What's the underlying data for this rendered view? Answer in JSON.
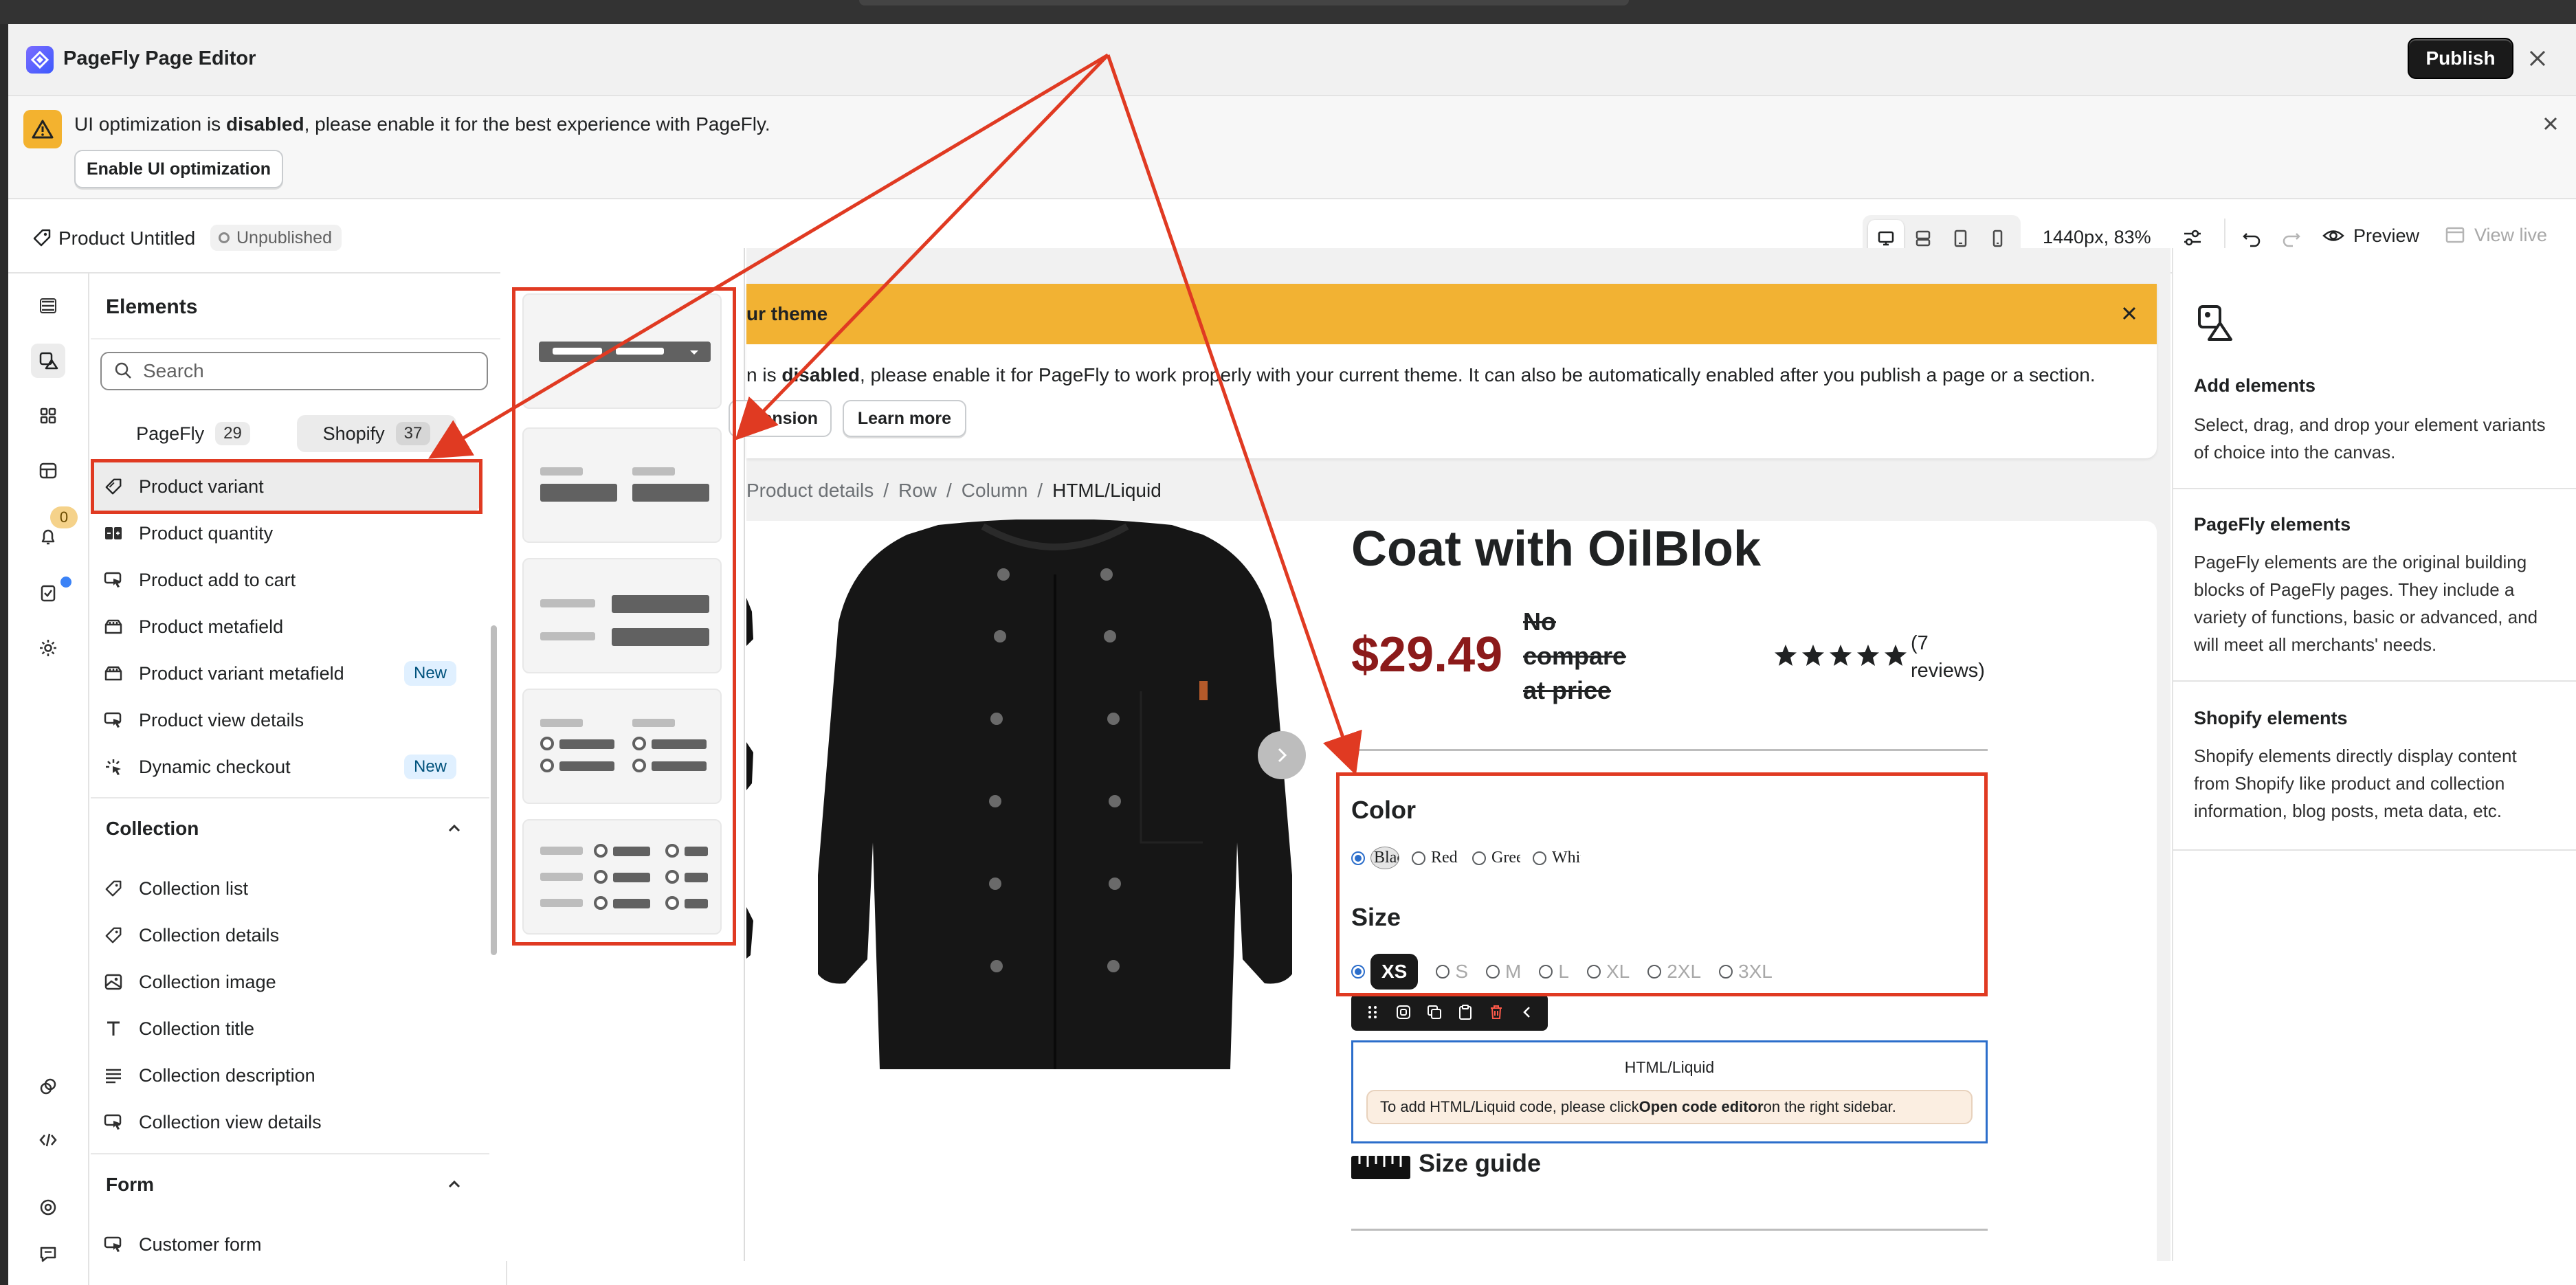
{
  "app": {
    "title": "PageFly Page Editor",
    "publish_label": "Publish"
  },
  "warning": {
    "text_pre": "UI optimization is ",
    "text_bold": "disabled",
    "text_post": ", please enable it for the best experience with PageFly.",
    "button_label": "Enable UI optimization"
  },
  "toolbar": {
    "page_name": "Product Untitled",
    "status": "Unpublished",
    "zoom": "1440px, 83%",
    "preview_label": "Preview",
    "view_live_label": "View live"
  },
  "rail": {
    "badge_count": "0"
  },
  "elements_panel": {
    "title": "Elements",
    "search_placeholder": "Search",
    "tabs": [
      {
        "label": "PageFly",
        "count": "29"
      },
      {
        "label": "Shopify",
        "count": "37"
      }
    ],
    "product_items": [
      {
        "label": "Product variant",
        "icon": "tag-icon"
      },
      {
        "label": "Product quantity",
        "icon": "quantity-icon"
      },
      {
        "label": "Product add to cart",
        "icon": "cursor-click-icon"
      },
      {
        "label": "Product metafield",
        "icon": "metafield-icon"
      },
      {
        "label": "Product variant metafield",
        "icon": "metafield-icon",
        "badge": "New"
      },
      {
        "label": "Product view details",
        "icon": "cursor-click-icon"
      },
      {
        "label": "Dynamic checkout",
        "icon": "checkout-icon",
        "badge": "New"
      }
    ],
    "collection_section": {
      "title": "Collection",
      "items": [
        {
          "label": "Collection list",
          "icon": "tag-icon"
        },
        {
          "label": "Collection details",
          "icon": "tag-icon"
        },
        {
          "label": "Collection image",
          "icon": "image-icon"
        },
        {
          "label": "Collection title",
          "icon": "text-icon"
        },
        {
          "label": "Collection description",
          "icon": "paragraph-icon"
        },
        {
          "label": "Collection view details",
          "icon": "cursor-click-icon"
        }
      ]
    },
    "form_section": {
      "title": "Form",
      "items": [
        {
          "label": "Customer form",
          "icon": "cursor-click-icon"
        }
      ]
    }
  },
  "canvas": {
    "theme_banner": {
      "title": "ur theme",
      "text_pre": "n is ",
      "text_bold": "disabled",
      "text_post": ", please enable it for PageFly to work properly with your current theme. It can also be automatically enabled after you publish a page or a section.",
      "extension_label": "tension",
      "learn_more_label": "Learn more"
    },
    "breadcrumb": [
      "Product details",
      "Row",
      "Column",
      "HTML/Liquid"
    ],
    "product": {
      "title": "Coat with OilBlok",
      "price": "$29.49",
      "compare_price": "No compare at price",
      "reviews": "(7 reviews)",
      "rating_stars": 5,
      "color_label": "Color",
      "color_options": [
        "Black",
        "Red",
        "Green",
        "White"
      ],
      "color_selected": "Black",
      "size_label": "Size",
      "size_options": [
        "XS",
        "S",
        "M",
        "L",
        "XL",
        "2XL",
        "3XL"
      ],
      "size_selected": "XS",
      "html_block_title": "HTML/Liquid",
      "html_note_pre": "To add HTML/Liquid code, please click ",
      "html_note_bold": "Open code editor",
      "html_note_post": " on the right sidebar.",
      "size_guide": "Size guide"
    }
  },
  "right_panel": {
    "sections": [
      {
        "title": "Add elements",
        "text": "Select, drag, and drop your element variants of choice into the canvas."
      },
      {
        "title": "PageFly elements",
        "text": "PageFly elements are the original building blocks of PageFly pages. They include a variety of functions, basic or advanced, and will meet all merchants' needs."
      },
      {
        "title": "Shopify elements",
        "text": "Shopify elements directly display content from Shopify like product and collection information, blog posts, meta data, etc."
      }
    ]
  },
  "colors": {
    "annotation_red": "#e03a22",
    "warning_yellow": "#f2b233",
    "price_red": "#8b1a1a",
    "selection_blue": "#2c6ecb",
    "new_badge_bg": "#e0f0ff"
  }
}
